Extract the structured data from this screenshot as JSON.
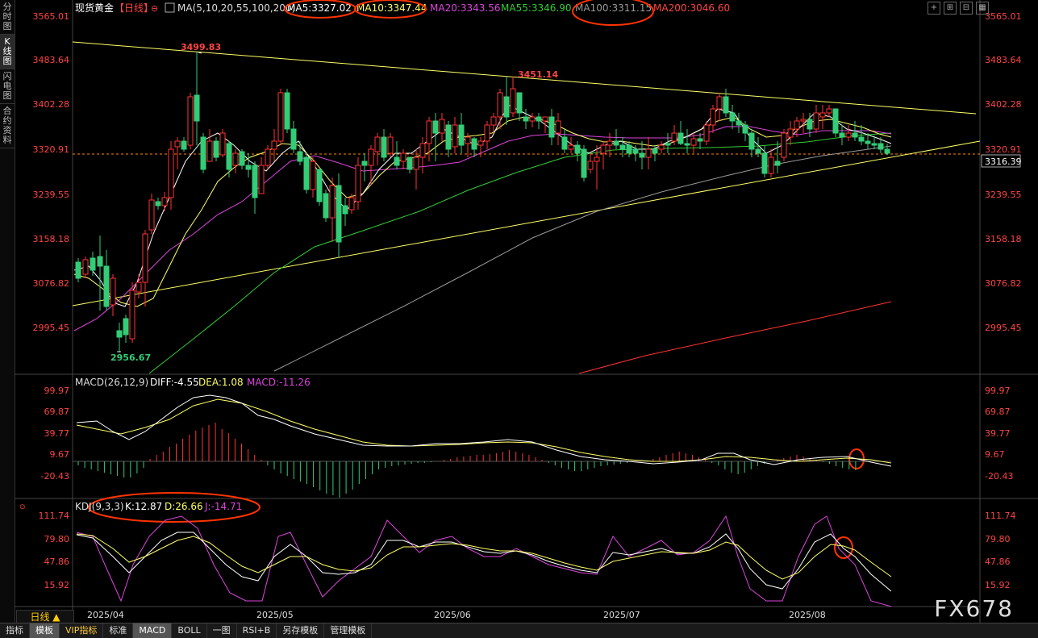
{
  "sidebar": {
    "tabs": [
      {
        "label": "分时图",
        "active": false
      },
      {
        "label": "K线图",
        "active": true
      },
      {
        "label": "闪电图",
        "active": false
      },
      {
        "label": "合约资料",
        "active": false
      }
    ]
  },
  "header": {
    "instrument": "现货黄金",
    "period_bracket": "【日线】",
    "ma_params": "MA(5,10,20,55,100,200)",
    "ma_values": [
      {
        "label": "MA5:3327.02",
        "color": "#ffffff"
      },
      {
        "label": "MA10:3347.44",
        "color": "#ffff66"
      },
      {
        "label": "MA20:3343.56",
        "color": "#dd44dd"
      },
      {
        "label": "MA55:3346.90",
        "color": "#33cc33"
      },
      {
        "label": "MA100:3311.15",
        "color": "#999999"
      },
      {
        "label": "MA200:3046.60",
        "color": "#ff4444"
      }
    ]
  },
  "price_axis": {
    "ticks": [
      "3565.01",
      "3483.64",
      "3402.28",
      "3320.91",
      "3239.55",
      "3158.18",
      "3076.82",
      "2995.45"
    ],
    "current_price": "3316.39"
  },
  "annotations": {
    "high_label": "3499.83",
    "mid_high_label": "3451.14",
    "low_label": "2956.67"
  },
  "macd": {
    "title": "MACD(26,12,9)",
    "diff": "DIFF:-4.55",
    "dea": "DEA:1.08",
    "macd": "MACD:-11.26",
    "ticks": [
      "99.97",
      "69.87",
      "39.77",
      "9.67",
      "-20.43"
    ]
  },
  "kdj": {
    "title": "KDJ(9,3,3)",
    "k": "K:12.87",
    "d": "D:26.66",
    "j": "J:-14.71",
    "ticks": [
      "111.74",
      "79.80",
      "47.86",
      "15.92"
    ]
  },
  "time_axis": {
    "labels": [
      "2025/04",
      "2025/05",
      "2025/06",
      "2025/07",
      "2025/08"
    ]
  },
  "period_tab": "日线 ▲",
  "bottom_tabs": [
    {
      "label": "指标",
      "active": false,
      "vip": false
    },
    {
      "label": "模板",
      "active": true,
      "vip": false
    },
    {
      "label": "VIP指标",
      "active": false,
      "vip": true
    },
    {
      "label": "标准",
      "active": false,
      "vip": false
    },
    {
      "label": "MACD",
      "active": true,
      "vip": false
    },
    {
      "label": "BOLL",
      "active": false,
      "vip": false
    },
    {
      "label": "一图",
      "active": false,
      "vip": false
    },
    {
      "label": "RSI+B",
      "active": false,
      "vip": false
    },
    {
      "label": "另存模板",
      "active": false,
      "vip": false
    },
    {
      "label": "管理模板",
      "active": false,
      "vip": false
    }
  ],
  "watermark": "FX678",
  "colors": {
    "up": "#ff3333",
    "down": "#33cc77",
    "axis_text": "#ff4444",
    "trendline": "#ffff66",
    "highlight_circle": "#ff3300"
  }
}
